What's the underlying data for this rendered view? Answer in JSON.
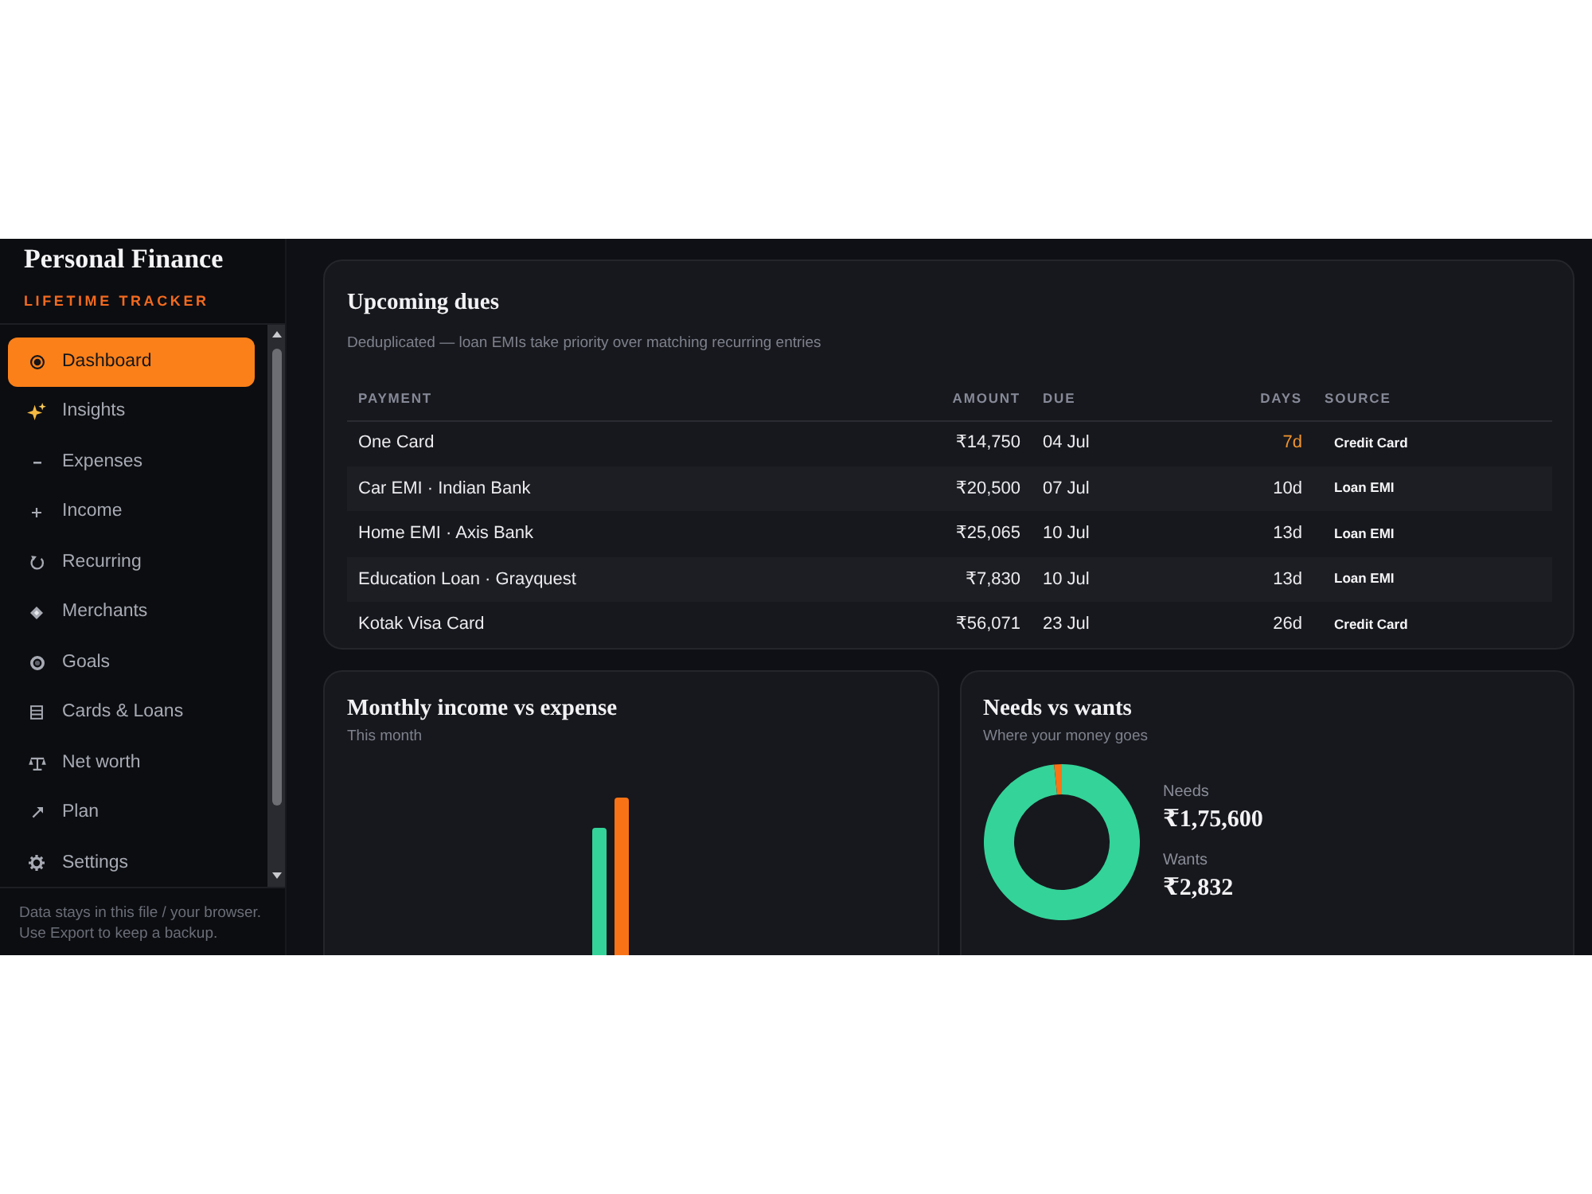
{
  "sidebar": {
    "brand": "Personal Finance",
    "tagline": "LIFETIME TRACKER",
    "items": [
      {
        "label": "Dashboard",
        "selected": true
      },
      {
        "label": "Insights",
        "selected": false
      },
      {
        "label": "Expenses",
        "selected": false
      },
      {
        "label": "Income",
        "selected": false
      },
      {
        "label": "Recurring",
        "selected": false
      },
      {
        "label": "Merchants",
        "selected": false
      },
      {
        "label": "Goals",
        "selected": false
      },
      {
        "label": "Cards & Loans",
        "selected": false
      },
      {
        "label": "Net worth",
        "selected": false
      },
      {
        "label": "Plan",
        "selected": false
      },
      {
        "label": "Settings",
        "selected": false
      }
    ],
    "footer": "Data stays in this file / your browser. Use Export to keep a backup."
  },
  "upcoming_dues": {
    "title": "Upcoming dues",
    "subtitle": "Deduplicated — loan EMIs take priority over matching recurring entries",
    "columns": [
      "PAYMENT",
      "AMOUNT",
      "DUE",
      "DAYS",
      "SOURCE"
    ],
    "rows": [
      {
        "payment": "One Card",
        "amount": "₹14,750",
        "due": "04 Jul",
        "days": "7d",
        "due_soon": true,
        "source": "Credit Card"
      },
      {
        "payment": "Car EMI · Indian Bank",
        "amount": "₹20,500",
        "due": "07 Jul",
        "days": "10d",
        "due_soon": false,
        "source": "Loan EMI"
      },
      {
        "payment": "Home EMI · Axis Bank",
        "amount": "₹25,065",
        "due": "10 Jul",
        "days": "13d",
        "due_soon": false,
        "source": "Loan EMI"
      },
      {
        "payment": "Education Loan · Grayquest",
        "amount": "₹7,830",
        "due": "10 Jul",
        "days": "13d",
        "due_soon": false,
        "source": "Loan EMI"
      },
      {
        "payment": "Kotak Visa Card",
        "amount": "₹56,071",
        "due": "23 Jul",
        "days": "26d",
        "due_soon": false,
        "source": "Credit Card"
      }
    ]
  },
  "income_vs_expense": {
    "title": "Monthly income vs expense",
    "subtitle": "This month"
  },
  "needs_vs_wants": {
    "title": "Needs vs wants",
    "subtitle": "Where your money goes",
    "chart_data": {
      "type": "donut",
      "categories": [
        "Needs",
        "Wants"
      ],
      "values": [
        98.41,
        1.59
      ]
    },
    "totals": [
      "₹1,75,600",
      "₹2,832"
    ]
  }
}
